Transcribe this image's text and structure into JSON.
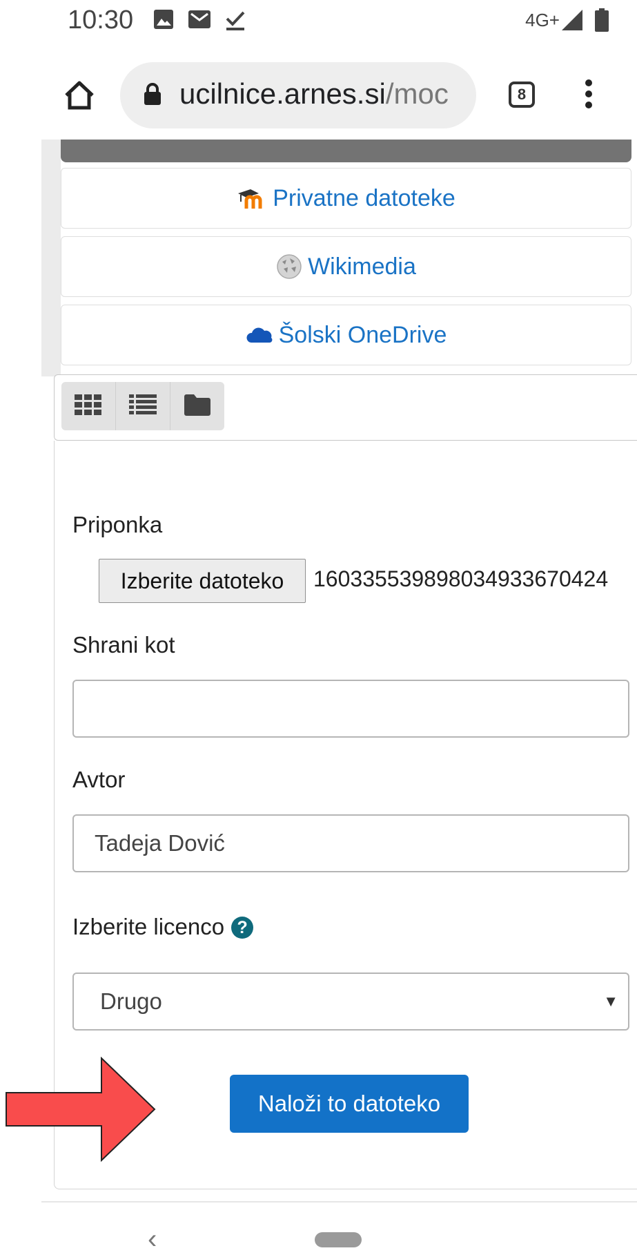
{
  "status_bar": {
    "time": "10:30",
    "network": "4G+",
    "icons": [
      "image-icon",
      "gmail-icon",
      "download-done-icon",
      "signal-icon",
      "battery-icon"
    ]
  },
  "browser": {
    "url_host": "ucilnice.arnes.si",
    "url_path": "/moc",
    "tab_count": "8"
  },
  "repositories": [
    {
      "label": "Privatne datoteke",
      "icon": "moodle-icon"
    },
    {
      "label": "Wikimedia",
      "icon": "wikipedia-globe-icon"
    },
    {
      "label": "Šolski OneDrive",
      "icon": "onedrive-cloud-icon"
    }
  ],
  "view_modes": [
    "grid-view-icon",
    "list-view-icon",
    "folder-view-icon"
  ],
  "form": {
    "attachment_label": "Priponka",
    "choose_file_button": "Izberite datoteko",
    "chosen_file_name": "16033553989803493367042​4",
    "save_as_label": "Shrani kot",
    "save_as_value": "",
    "author_label": "Avtor",
    "author_value": "Tadeja Dović",
    "license_label": "Izberite licenco",
    "license_value": "Drugo",
    "upload_button": "Naloži to datoteko"
  },
  "colors": {
    "link": "#1a73c5",
    "primary_button": "#1372c8",
    "help_icon": "#0f6a7c",
    "annotation_arrow": "#f94c4c"
  }
}
